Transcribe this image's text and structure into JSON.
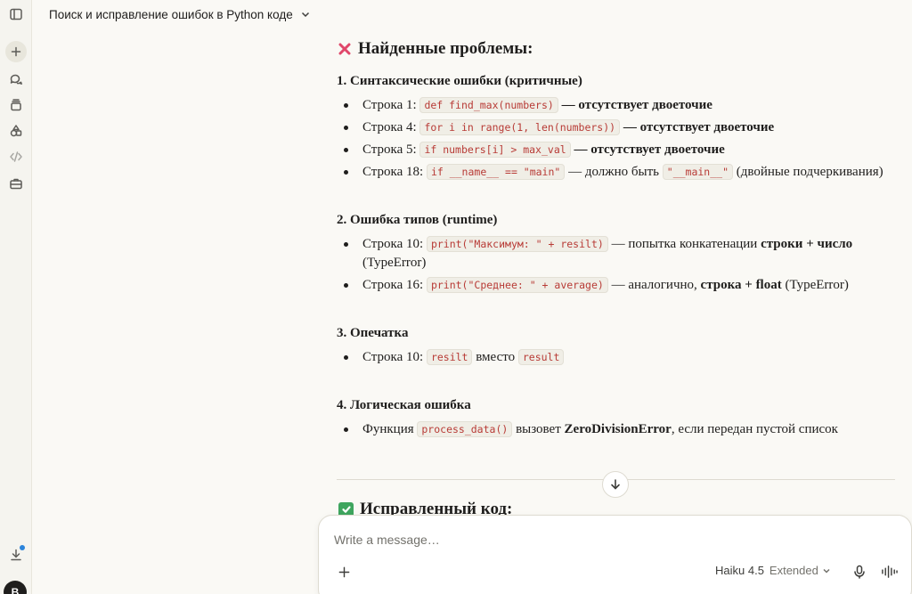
{
  "header": {
    "title": "Поиск и исправление ошибок в Python коде"
  },
  "sections": {
    "problems_heading": "Найденные проблемы:",
    "s1": {
      "title": "1. Синтаксические ошибки (критичные)",
      "items": [
        {
          "pre": "Строка 1:",
          "code": "def find_max(numbers)",
          "post_bold": "— отсутствует двоеточие"
        },
        {
          "pre": "Строка 4:",
          "code": "for i in range(1, len(numbers))",
          "post_bold": "— отсутствует двоеточие"
        },
        {
          "pre": "Строка 5:",
          "code": "if numbers[i] > max_val",
          "post_bold": "— отсутствует двоеточие"
        },
        {
          "pre": "Строка 18:",
          "code": "if __name__ == \"main\"",
          "mid": "— должно быть",
          "code2": "\"__main__\"",
          "post": "(двойные подчеркивания)"
        }
      ]
    },
    "s2": {
      "title": "2. Ошибка типов (runtime)",
      "items": [
        {
          "pre": "Строка 10:",
          "code": "print(\"Максимум: \" + resilt)",
          "mid": "— попытка конкатенации",
          "b1": "строки",
          "plus": "+",
          "b2": "число",
          "post": "(TypeError)"
        },
        {
          "pre": "Строка 16:",
          "code": "print(\"Среднее: \" + average)",
          "mid": "— аналогично,",
          "b1": "строка",
          "plus": "+",
          "b2": "float",
          "post": "(TypeError)"
        }
      ]
    },
    "s3": {
      "title": "3. Опечатка",
      "items": [
        {
          "pre": "Строка 10:",
          "code": "resilt",
          "mid": "вместо",
          "code2": "result"
        }
      ]
    },
    "s4": {
      "title": "4. Логическая ошибка",
      "items": [
        {
          "pre": "Функция",
          "code": "process_data()",
          "mid": "вызовет",
          "bold": "ZeroDivisionError",
          "post": ", если передан пустой список"
        }
      ]
    },
    "fixed_heading": "Исправленный код:"
  },
  "composer": {
    "placeholder": "Write a message…",
    "model_name": "Haiku 4.5",
    "model_mode": "Extended"
  },
  "user": {
    "avatar_initial": "B"
  },
  "icons": [
    "sidebar-toggle-icon",
    "plus-icon",
    "chats-icon",
    "projects-icon",
    "artifacts-icon",
    "code-icon",
    "briefcase-icon",
    "download-icon",
    "chevron-down-icon",
    "cross-mark-icon",
    "check-mark-icon",
    "arrow-down-icon",
    "mic-icon",
    "voice-icon"
  ],
  "colors": {
    "accent_dot": "#2c84db",
    "code_text": "#b83b36",
    "cross": "#e0476a",
    "check": "#3ea55e"
  }
}
